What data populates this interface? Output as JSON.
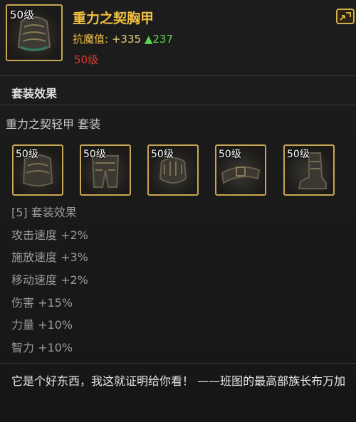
{
  "item": {
    "level_badge": "50级",
    "name": "重力之契胸甲",
    "magic_res_label": "抗魔值:",
    "magic_res_value": "+335",
    "magic_res_bonus": "▲237",
    "required_level": "50级",
    "corner_icon": "expand-icon"
  },
  "set": {
    "section_title": "套装效果",
    "set_name": "重力之契轻甲 套装",
    "pieces": [
      {
        "level_badge": "50级",
        "icon": "chest-armor-icon"
      },
      {
        "level_badge": "50级",
        "icon": "leg-armor-icon"
      },
      {
        "level_badge": "50级",
        "icon": "gauntlet-icon"
      },
      {
        "level_badge": "50级",
        "icon": "belt-icon"
      },
      {
        "level_badge": "50级",
        "icon": "boots-icon"
      }
    ],
    "effects": [
      "[5] 套装效果",
      "攻击速度 +2%",
      "施放速度 +3%",
      "移动速度 +2%",
      "伤害 +15%",
      "力量 +10%",
      "智力 +10%"
    ]
  },
  "flavor_text": "它是个好东西，我这就证明给你看！ ——班图的最高部族长布万加",
  "colors": {
    "border_gold": "#c8a653",
    "item_name": "#f0c040",
    "bonus_green": "#5fd64f",
    "level_red": "#e03a2f"
  }
}
